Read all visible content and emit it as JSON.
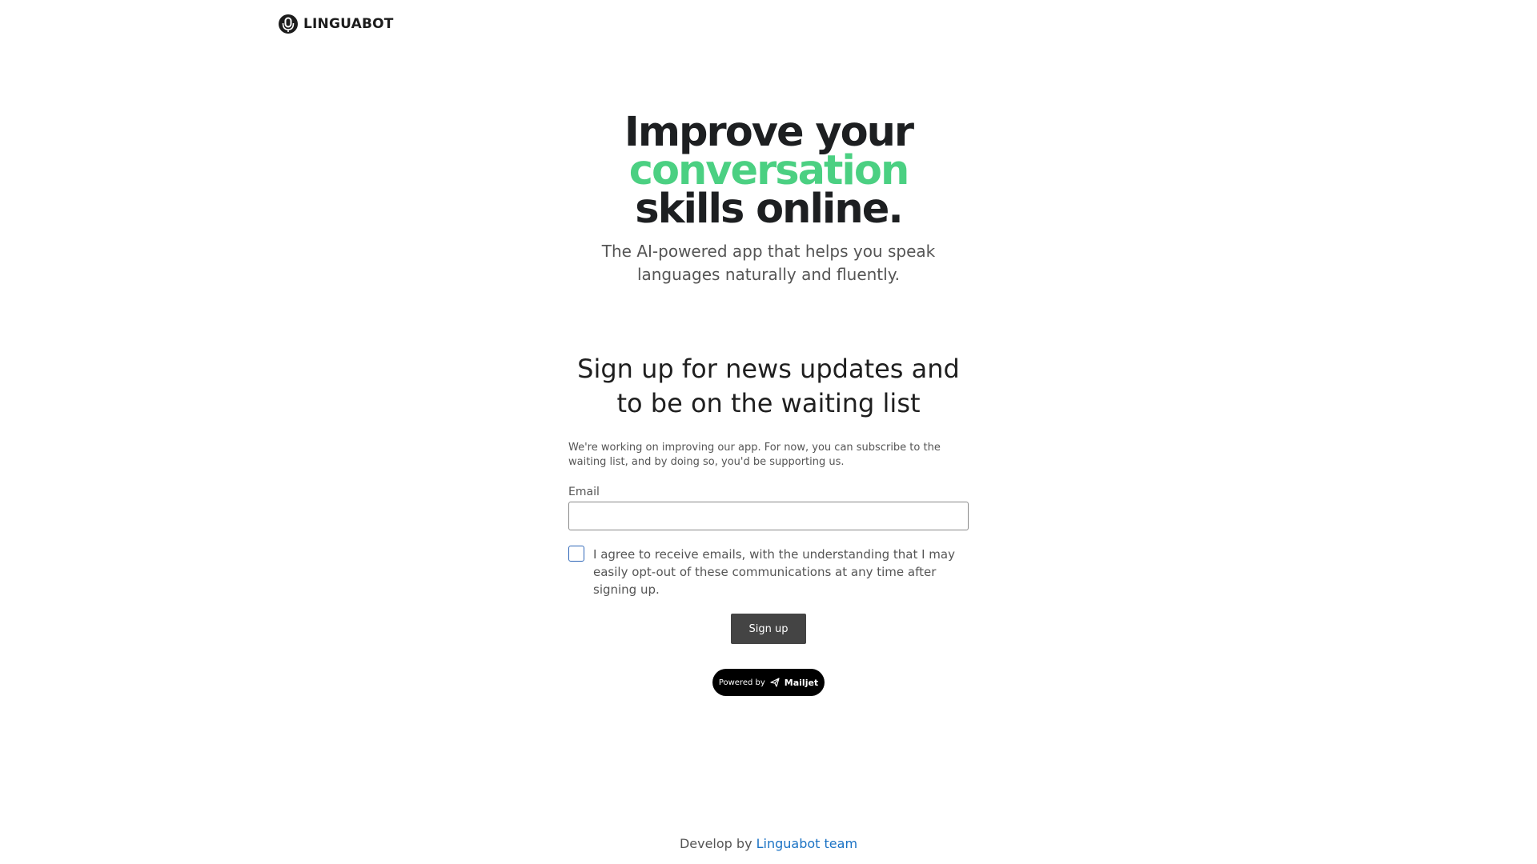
{
  "header": {
    "brand": "LINGUABOT",
    "logo_icon": "microphone-icon"
  },
  "hero": {
    "title_line1": "Improve your",
    "title_line2": "conversation",
    "title_line3": "skills online.",
    "accent_color": "#4bd082",
    "subtitle": "The AI-powered app that helps you speak languages naturally and fluently."
  },
  "signup": {
    "title": "Sign up for news updates and to be on the waiting list",
    "description": "We're working on improving our app. For now, you can subscribe to the waiting list, and by doing so, you'd be supporting us.",
    "email_label": "Email",
    "email_value": "",
    "consent_text": "I agree to receive emails, with the understanding that I may easily opt-out of these communications at any time after signing up.",
    "consent_checked": false,
    "button_label": "Sign up",
    "button_color": "#444444"
  },
  "powered_by": {
    "prefix": "Powered by",
    "brand": "Mailjet",
    "icon": "paper-plane-icon"
  },
  "footer": {
    "prefix": "Develop by",
    "link_text": "Linguabot team",
    "link_color": "#1a72c4"
  }
}
